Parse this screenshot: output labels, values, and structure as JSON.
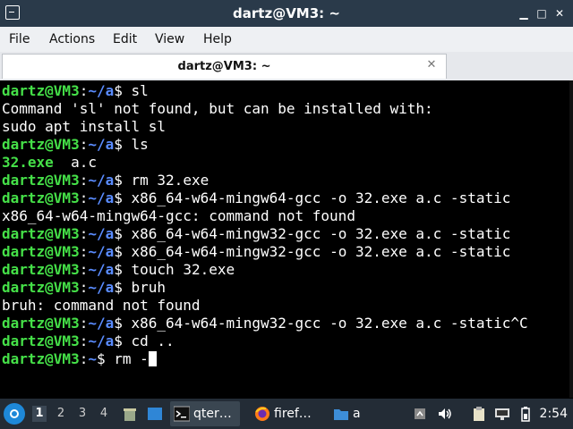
{
  "window": {
    "title": "dartz@VM3: ~"
  },
  "window_controls": {
    "minimize": "▁",
    "maximize": "□",
    "close": "✕"
  },
  "menubar": {
    "items": [
      "File",
      "Actions",
      "Edit",
      "View",
      "Help"
    ]
  },
  "tab": {
    "label": "dartz@VM3: ~",
    "close": "✕"
  },
  "terminal": {
    "prompt_user": "dartz@VM3",
    "prompt_sep": ":",
    "path_sub": "~/a",
    "path_home": "~",
    "prompt_dollar": "$ ",
    "lines": [
      {
        "kind": "prompt",
        "cmd": "sl"
      },
      {
        "kind": "output",
        "text": "Command 'sl' not found, but can be installed with:"
      },
      {
        "kind": "output",
        "text": "sudo apt install sl"
      },
      {
        "kind": "prompt",
        "cmd": "ls"
      },
      {
        "kind": "ls",
        "exe": "32.exe",
        "rest": "  a.c"
      },
      {
        "kind": "prompt",
        "cmd": "rm 32.exe"
      },
      {
        "kind": "prompt",
        "cmd": "x86_64-w64-mingw64-gcc -o 32.exe a.c -static"
      },
      {
        "kind": "output",
        "text": "x86_64-w64-mingw64-gcc: command not found"
      },
      {
        "kind": "prompt",
        "cmd": "x86_64-w64-mingw32-gcc -o 32.exe a.c -static"
      },
      {
        "kind": "prompt",
        "cmd": "x86_64-w64-mingw32-gcc -o 32.exe a.c -static"
      },
      {
        "kind": "prompt",
        "cmd": "touch 32.exe"
      },
      {
        "kind": "prompt",
        "cmd": "bruh"
      },
      {
        "kind": "output",
        "text": "bruh: command not found"
      },
      {
        "kind": "prompt",
        "cmd": "x86_64-w64-mingw32-gcc -o 32.exe a.c -static^C"
      },
      {
        "kind": "prompt",
        "cmd": "cd .."
      },
      {
        "kind": "home_prompt",
        "cmd": "rm -"
      }
    ]
  },
  "taskbar": {
    "start_icon": "start-menu-icon",
    "desktops": [
      "1",
      "2",
      "3",
      "4"
    ],
    "active_desktop": "1",
    "tasks": [
      {
        "label": "qter…",
        "icon": "terminal-icon",
        "active": true
      },
      {
        "label": "firef…",
        "icon": "firefox-icon",
        "active": false
      },
      {
        "label": "a",
        "icon": "folder-icon",
        "active": false
      }
    ],
    "clock": "2:54"
  },
  "colors": {
    "prompt_user": "#45e048",
    "prompt_path": "#5a8cff",
    "titlebar_bg": "#2a3a4a",
    "taskbar_bg": "#232c36"
  }
}
